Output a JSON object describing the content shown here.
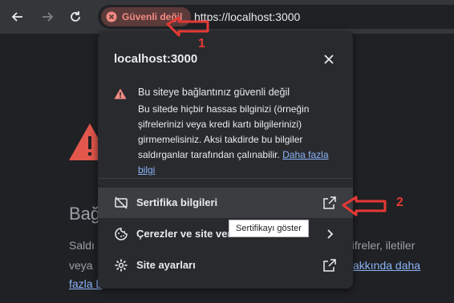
{
  "toolbar": {
    "security_chip": {
      "label": "Güvenli değil",
      "icon": "x-circle-icon",
      "color": "#f28b82"
    },
    "url": "https://localhost:3000",
    "back_icon": "arrow-left-icon",
    "forward_icon": "arrow-right-icon",
    "reload_icon": "reload-icon"
  },
  "background_page": {
    "heading": "Bağ",
    "line1_start": "Saldı",
    "line1_end": ", şifreler, iletiler",
    "line2_start": "veya",
    "line2_link": "akkında daha",
    "line3_link": "fazla b",
    "warning_icon": "warning-triangle-icon"
  },
  "popup": {
    "title": "localhost:3000",
    "close_icon": "close-icon",
    "warning": {
      "icon": "warning-triangle-icon",
      "title": "Bu siteye bağlantınız güvenli değil",
      "body_lines": [
        "Bu sitede hiçbir hassas bilginizi (örneğin",
        "şifrelerinizi veya kredi kartı bilgilerinizi)",
        "girmemelisiniz. Aksi takdirde bu bilgiler",
        "saldırganlar tarafından çalınabilir."
      ],
      "link_part1": "Daha fazla",
      "link_part2": "bilgi"
    },
    "menu": [
      {
        "label": "Sertifika bilgileri",
        "icon": "certificate-off-icon",
        "trailing_icon": "open-external-icon"
      },
      {
        "label": "Çerezler ve site veri",
        "icon": "cookie-icon",
        "trailing_icon": "chevron-right-icon"
      },
      {
        "label": "Site ayarları",
        "icon": "gear-icon",
        "trailing_icon": "open-external-icon"
      }
    ]
  },
  "tooltip": {
    "text": "Sertifikayı göster"
  },
  "annotations": [
    {
      "number": "1",
      "color": "#e53935"
    },
    {
      "number": "2",
      "color": "#e53935"
    }
  ]
}
